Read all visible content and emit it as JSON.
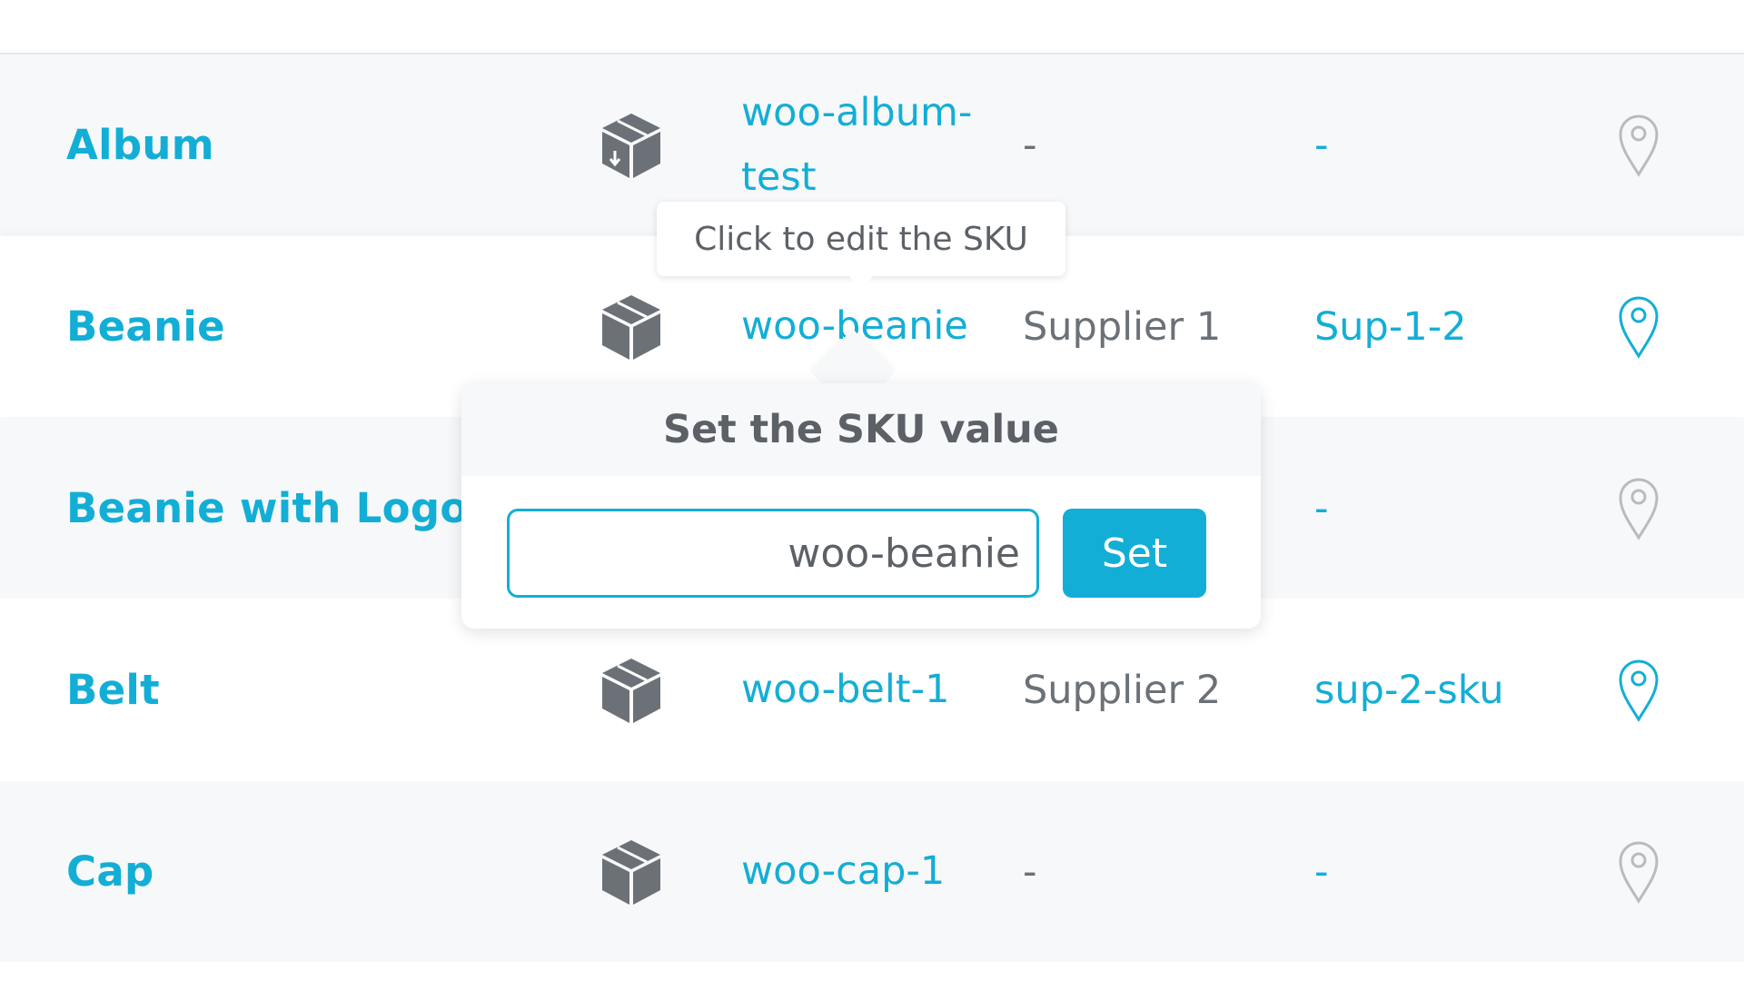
{
  "colors": {
    "accent": "#13aed6",
    "text_gray": "#6b7177",
    "icon_gray": "#6b7177",
    "pin_inactive": "#b8bcc0"
  },
  "products": [
    {
      "name": "Album",
      "type_icon": "download-box-icon",
      "sku": "woo-album-test",
      "supplier": "-",
      "supplier_sku": "-",
      "location_icon": "map-pin-icon",
      "location_active": false
    },
    {
      "name": "Beanie",
      "type_icon": "box-icon",
      "sku": "woo-beanie",
      "supplier": "Supplier 1",
      "supplier_sku": "Sup-1-2",
      "location_icon": "map-pin-icon",
      "location_active": true
    },
    {
      "name": "Beanie with Logo",
      "type_icon": "box-icon",
      "sku": "",
      "supplier": "",
      "supplier_sku": "-",
      "location_icon": "map-pin-icon",
      "location_active": false
    },
    {
      "name": "Belt",
      "type_icon": "box-icon",
      "sku": "woo-belt-1",
      "supplier": "Supplier 2",
      "supplier_sku": "sup-2-sku",
      "location_icon": "map-pin-icon",
      "location_active": true
    },
    {
      "name": "Cap",
      "type_icon": "box-icon",
      "sku": "woo-cap-1",
      "supplier": "-",
      "supplier_sku": "-",
      "location_icon": "map-pin-icon",
      "location_active": false
    }
  ],
  "tooltip": {
    "text": "Click to edit the SKU"
  },
  "sku_popover": {
    "title": "Set the SKU value",
    "input_value": "woo-beanie",
    "button_label": "Set"
  }
}
